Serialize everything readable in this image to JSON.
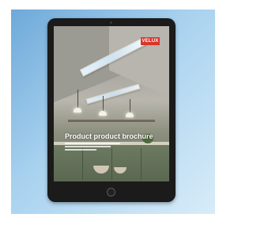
{
  "brochure": {
    "logo_text": "VELUX",
    "title": "Product product brochure",
    "subtitle": ""
  },
  "colors": {
    "backdrop_light": "#d8ecf8",
    "backdrop_dark": "#6ea9d9",
    "tablet_frame": "#1b1b1b",
    "logo_red": "#d9352a"
  }
}
